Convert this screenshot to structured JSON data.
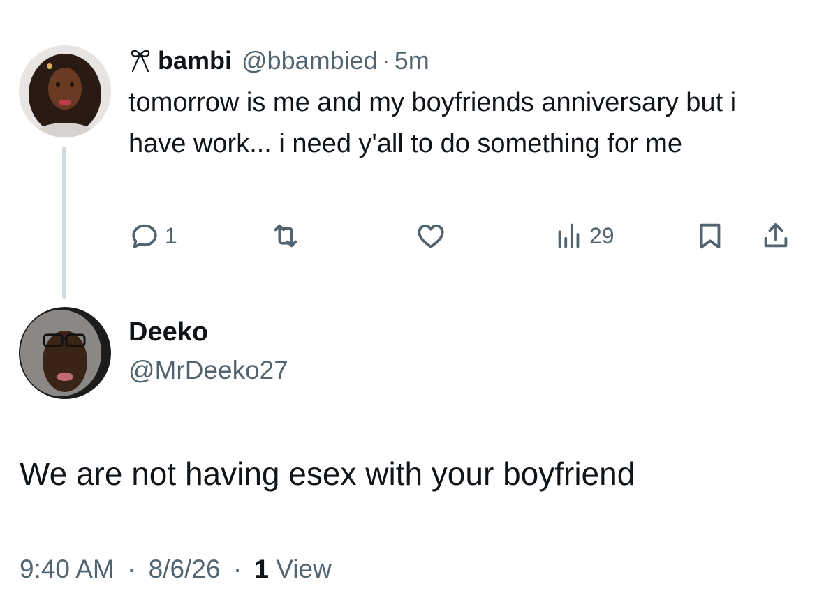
{
  "parent_tweet": {
    "display_name": "bambi",
    "handle": "@bbambied",
    "separator": "·",
    "age": "5m",
    "badge_icon": "bow-icon",
    "text": "tomorrow is me and my boyfriends anniversary but i have work... i need y'all to do something for me",
    "actions": {
      "reply_count": "1",
      "views_count": "29"
    }
  },
  "reply_tweet": {
    "display_name": "Deeko",
    "handle": "@MrDeeko27",
    "text": "We are not having esex with your boyfriend",
    "time": "9:40 AM",
    "date": "8/6/26",
    "separator": "·",
    "views_count": "1",
    "views_label": "View"
  },
  "colors": {
    "text_primary": "#0f1419",
    "text_secondary": "#536471",
    "thread_line": "#cfd9de",
    "background": "#ffffff"
  }
}
